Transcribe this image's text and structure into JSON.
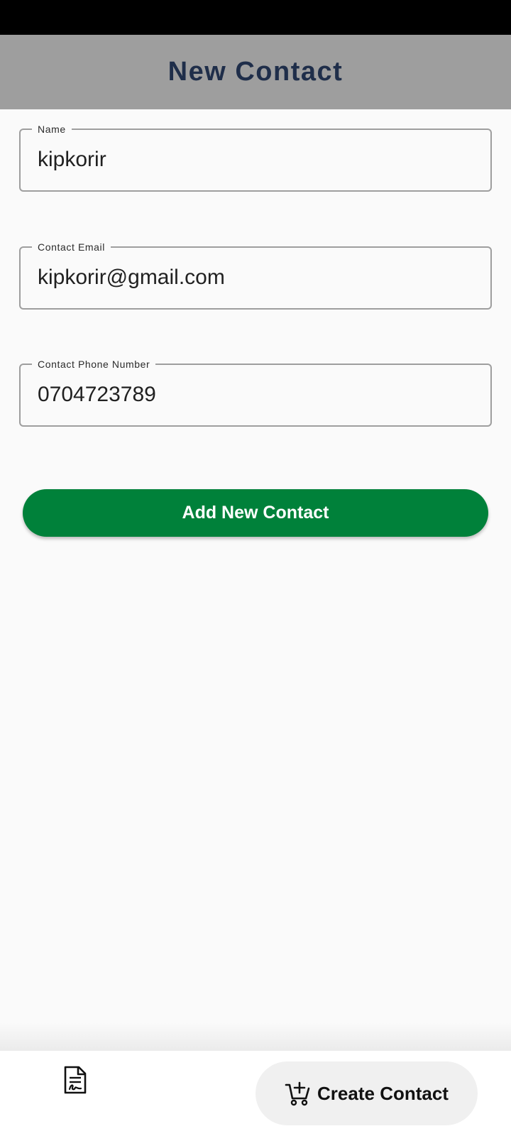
{
  "app_bar": {
    "title": "New Contact"
  },
  "form": {
    "name": {
      "label": "Name",
      "value": "kipkorir"
    },
    "email": {
      "label": "Contact Email",
      "value": "kipkorir@gmail.com"
    },
    "phone": {
      "label": "Contact Phone Number",
      "value": "0704723789"
    },
    "submit_label": "Add New Contact"
  },
  "bottom_nav": {
    "items": [
      {
        "icon": "document-signature-icon",
        "label": ""
      },
      {
        "icon": "cart-add-icon",
        "label": "Create Contact"
      }
    ]
  },
  "colors": {
    "app_bar": "#9e9e9e",
    "title_text": "#1f2e4a",
    "primary_button": "#00813a",
    "field_border": "#9e9e9e",
    "background": "#fafafa"
  }
}
